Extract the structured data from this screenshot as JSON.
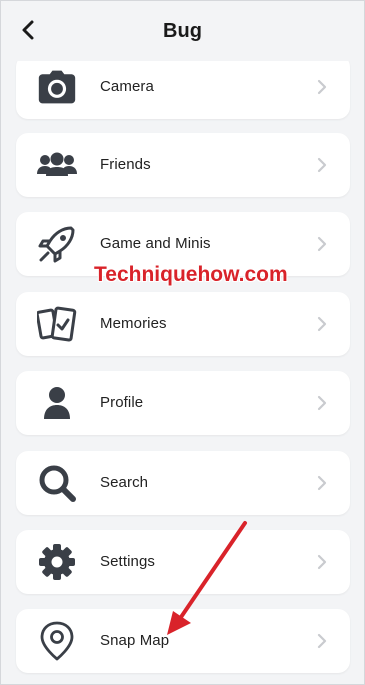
{
  "header": {
    "title": "Bug"
  },
  "items": [
    {
      "label": "Camera",
      "icon": "camera-icon"
    },
    {
      "label": "Friends",
      "icon": "friends-icon"
    },
    {
      "label": "Game and Minis",
      "icon": "rocket-icon"
    },
    {
      "label": "Memories",
      "icon": "memories-icon"
    },
    {
      "label": "Profile",
      "icon": "person-icon"
    },
    {
      "label": "Search",
      "icon": "search-icon"
    },
    {
      "label": "Settings",
      "icon": "gear-icon"
    },
    {
      "label": "Snap Map",
      "icon": "map-pin-icon"
    }
  ],
  "watermark": "Techniquehow.com",
  "colors": {
    "icon": "#3a3f47",
    "chevron": "#c9cbcf",
    "watermark": "#d9232a",
    "arrow": "#d9232a"
  }
}
